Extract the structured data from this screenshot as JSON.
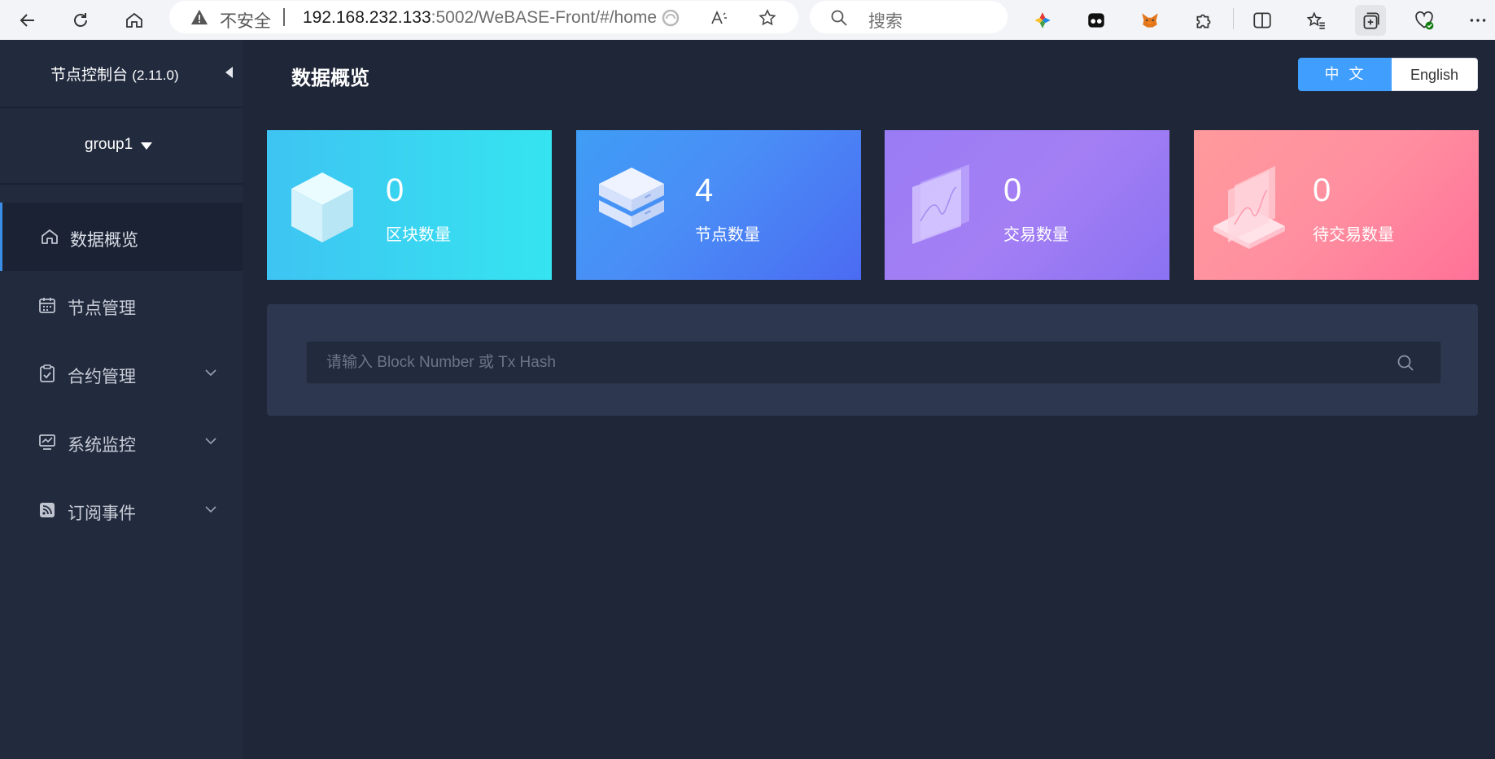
{
  "browser": {
    "insecure_label": "不安全",
    "url_host": "192.168.232.133",
    "url_path": ":5002/WeBASE-Front/#/home",
    "search_placeholder": "搜索"
  },
  "sidebar": {
    "title": "节点控制台",
    "version": "(2.11.0)",
    "group": "group1",
    "items": [
      {
        "label": "数据概览",
        "icon": "home-icon",
        "active": true
      },
      {
        "label": "节点管理",
        "icon": "calendar-icon",
        "active": false
      },
      {
        "label": "合约管理",
        "icon": "clipboard-icon",
        "active": false,
        "expandable": true
      },
      {
        "label": "系统监控",
        "icon": "monitor-chart-icon",
        "active": false,
        "expandable": true
      },
      {
        "label": "订阅事件",
        "icon": "rss-icon",
        "active": false,
        "expandable": true
      }
    ]
  },
  "header": {
    "page_title": "数据概览",
    "lang_zh": "中文",
    "lang_en": "English"
  },
  "cards": [
    {
      "value": "0",
      "label": "区块数量",
      "icon": "cube-icon"
    },
    {
      "value": "4",
      "label": "节点数量",
      "icon": "server-icon"
    },
    {
      "value": "0",
      "label": "交易数量",
      "icon": "chart-panel-icon"
    },
    {
      "value": "0",
      "label": "待交易数量",
      "icon": "pending-panel-icon"
    }
  ],
  "search": {
    "placeholder": "请输入 Block Number 或 Tx Hash"
  },
  "colors": {
    "accent": "#409eff",
    "sidebar_bg": "#222b3e",
    "main_bg": "#1f2638",
    "panel_bg": "#2d374f"
  }
}
